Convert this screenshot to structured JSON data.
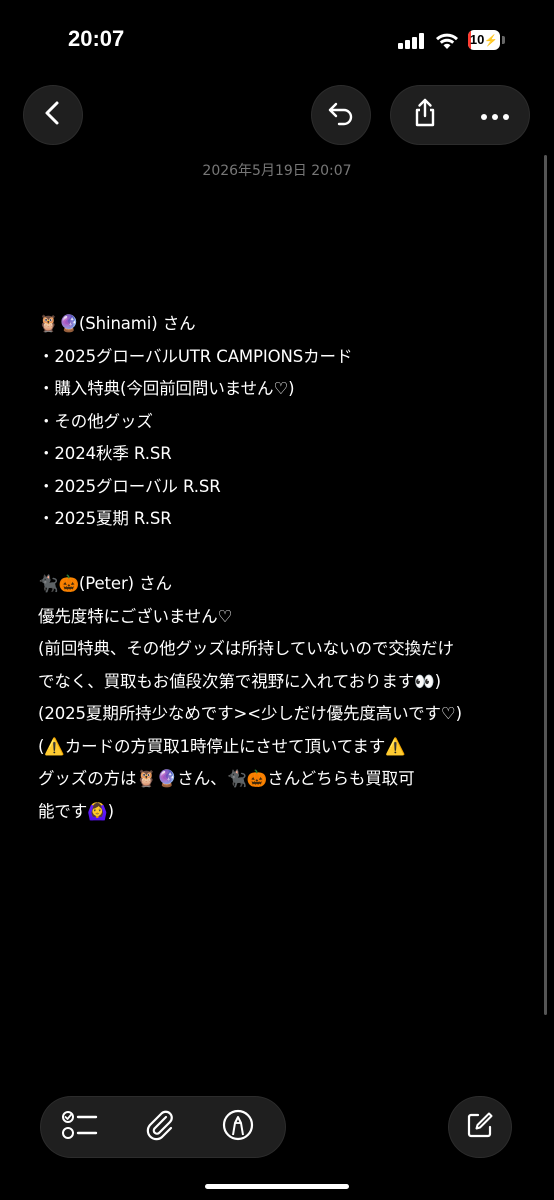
{
  "status_bar": {
    "time": "20:07",
    "battery_level": "10",
    "battery_fraction": 0.1,
    "battery_color": "#ff3b30"
  },
  "nav": {
    "back_icon": "chevron-left-icon",
    "undo_icon": "undo-icon",
    "share_icon": "share-icon",
    "more_icon": "ellipsis-icon"
  },
  "note": {
    "date": "2026年5月19日 20:07",
    "lines": [
      "🦉🔮(Shinami) さん",
      "・2025グローバルUTR CAMPIONSカード",
      "・購入特典(今回前回問いません♡)",
      "・その他グッズ",
      "・2024秋季 R.SR",
      "・2025グローバル R.SR",
      "・2025夏期 R.SR",
      "",
      "🐈‍⬛🎃(Peter) さん",
      "優先度特にございません♡",
      "(前回特典、その他グッズは所持していないので交換だけ",
      "でなく、買取もお値段次第で視野に入れております👀)",
      "(2025夏期所持少なめです><少しだけ優先度高いです♡)",
      "(⚠️カードの方買取1時停止にさせて頂いてます⚠️",
      "グッズの方は🦉🔮さん、🐈‍⬛🎃さんどちらも買取可",
      "能です🙆‍♀️)"
    ]
  },
  "toolbar": {
    "checklist_icon": "checklist-icon",
    "attachment_icon": "paperclip-icon",
    "markup_icon": "markup-pen-icon",
    "compose_icon": "compose-icon"
  }
}
